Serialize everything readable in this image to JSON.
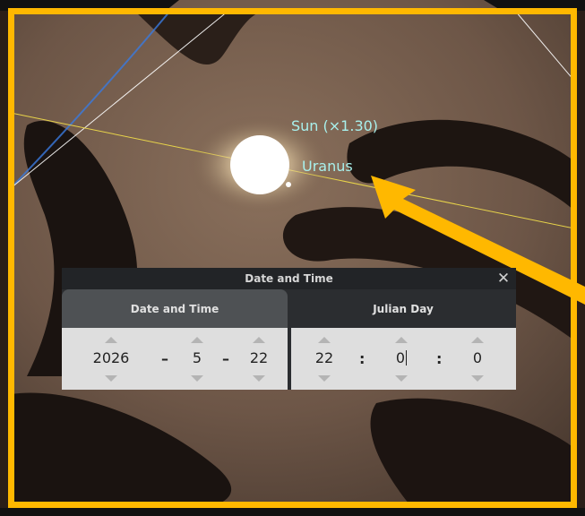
{
  "sky": {
    "sun_label": "Sun (×1.30)",
    "planet_label": "Uranus"
  },
  "highlight_color": "#FFB800",
  "label_color": "#A8F0EC",
  "dialog": {
    "title": "Date and Time",
    "close_icon": "✕",
    "tabs": [
      {
        "label": "Date and Time",
        "active": true
      },
      {
        "label": "Julian Day",
        "active": false
      }
    ],
    "date": {
      "year": "2026",
      "month": "5",
      "day": "22",
      "separator": "–"
    },
    "time": {
      "hour": "22",
      "minute": "0",
      "second": "0",
      "separator": ":"
    }
  }
}
